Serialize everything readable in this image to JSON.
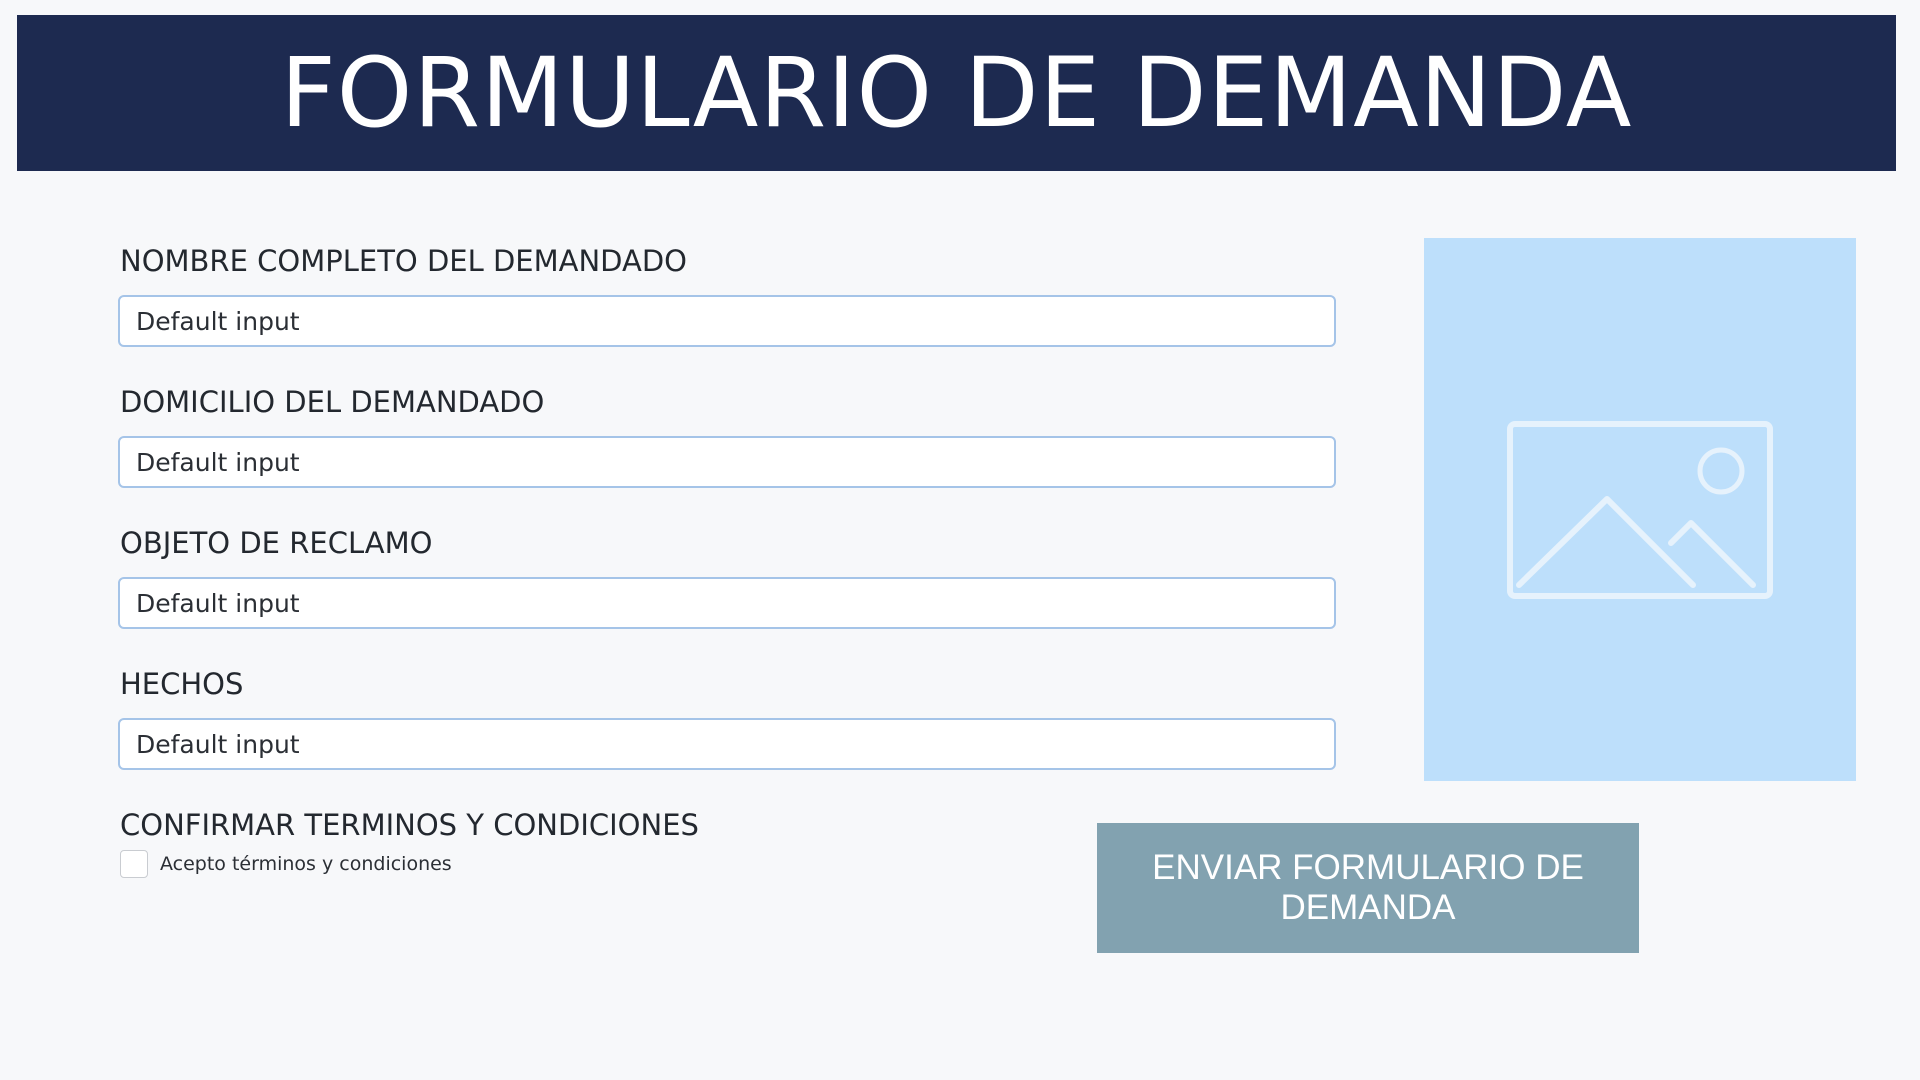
{
  "header": {
    "title": "FORMULARIO DE DEMANDA"
  },
  "form": {
    "fields": [
      {
        "label": "NOMBRE COMPLETO DEL DEMANDADO",
        "placeholder": "Default input",
        "value": ""
      },
      {
        "label": "DOMICILIO DEL DEMANDADO",
        "placeholder": "Default input",
        "value": ""
      },
      {
        "label": "OBJETO DE RECLAMO",
        "placeholder": "Default input",
        "value": ""
      },
      {
        "label": "HECHOS",
        "placeholder": "Default input",
        "value": ""
      }
    ],
    "terms": {
      "heading": "CONFIRMAR TERMINOS Y CONDICIONES",
      "checkbox_label": "Acepto términos y condiciones",
      "checked": false
    },
    "submit_label": "ENVIAR FORMULARIO DE DEMANDA"
  },
  "image_placeholder": {
    "icon": "image-icon"
  },
  "colors": {
    "header_bg": "#1d2a50",
    "page_bg": "#f7f8fa",
    "input_border": "#a5c4e8",
    "image_bg": "#bddffb",
    "button_bg": "#82a2b0"
  }
}
